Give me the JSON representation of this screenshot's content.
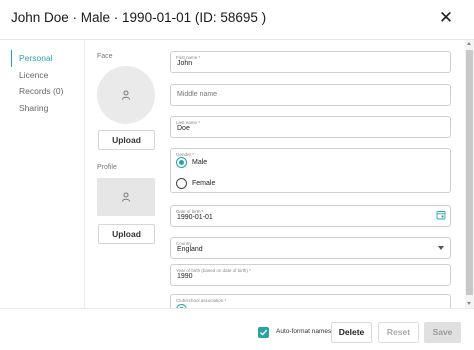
{
  "header": {
    "title": "John Doe · Male · 1990-01-01 (ID: 58695 )"
  },
  "nav": {
    "items": [
      {
        "label": "Personal"
      },
      {
        "label": "Licence"
      },
      {
        "label": "Records (0)"
      },
      {
        "label": "Sharing"
      }
    ],
    "active_index": 0
  },
  "media": {
    "face_label": "Face",
    "profile_label": "Profile",
    "upload_label": "Upload",
    "icon": "person-icon"
  },
  "form": {
    "first_name": {
      "label": "First name *",
      "value": "John"
    },
    "middle_name": {
      "placeholder": "Middle name"
    },
    "last_name": {
      "label": "Last name *",
      "value": "Doe"
    },
    "gender": {
      "label": "Gender *",
      "options": [
        "Male",
        "Female"
      ],
      "selected": "Male"
    },
    "date_of_birth": {
      "label": "Date of birth *",
      "value": "1990-01-01",
      "icon": "calendar-icon"
    },
    "country": {
      "label": "Country",
      "value": "England",
      "icon": "caret-down-icon"
    },
    "year_of_birth": {
      "label": "Year of birth (based on date of birth) *",
      "value": "1990"
    },
    "club_association": {
      "label": "Club/school association *"
    }
  },
  "footer": {
    "autoformat_label": "Auto-format names",
    "autoformat_checked": true,
    "delete_label": "Delete",
    "reset_label": "Reset",
    "save_label": "Save"
  },
  "colors": {
    "accent": "#29a3a3",
    "disabled_bg": "#e0e0e0",
    "placeholder_bg": "#eaeaea"
  }
}
